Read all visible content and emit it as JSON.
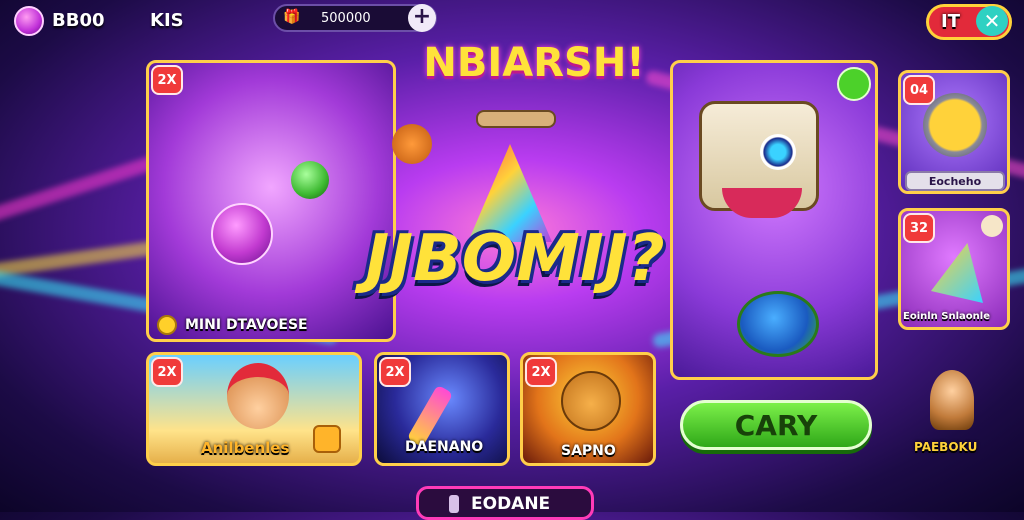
{
  "topbar": {
    "currency_label": "BB00",
    "player_tag": "KIS",
    "pill_value": "500000",
    "plus_label": "+",
    "close_label": "IT",
    "x_label": "✕"
  },
  "hero": {
    "banner_title": "NBIARSH!",
    "big_title": "JJBOMIJ?",
    "featured_card": {
      "badge": "2X",
      "label": "MINI DTAVOESE"
    }
  },
  "cards": [
    {
      "badge": "2X",
      "label": "Anilbenles"
    },
    {
      "badge": "2X",
      "label": "DAENANO"
    },
    {
      "badge": "2X",
      "label": "SAPNO"
    }
  ],
  "monster_card": {
    "play_button": "CARY"
  },
  "side_cards": [
    {
      "badge": "04",
      "label": "Eocheho"
    },
    {
      "badge": "32",
      "label": "Eoinln Snlaonle"
    }
  ],
  "side_mascot_label": "PAEBOKU",
  "bottom_button": "EODANE",
  "colors": {
    "accent": "#ffcf4a",
    "play": "#4cd12a",
    "badge": "#f03a3a"
  }
}
